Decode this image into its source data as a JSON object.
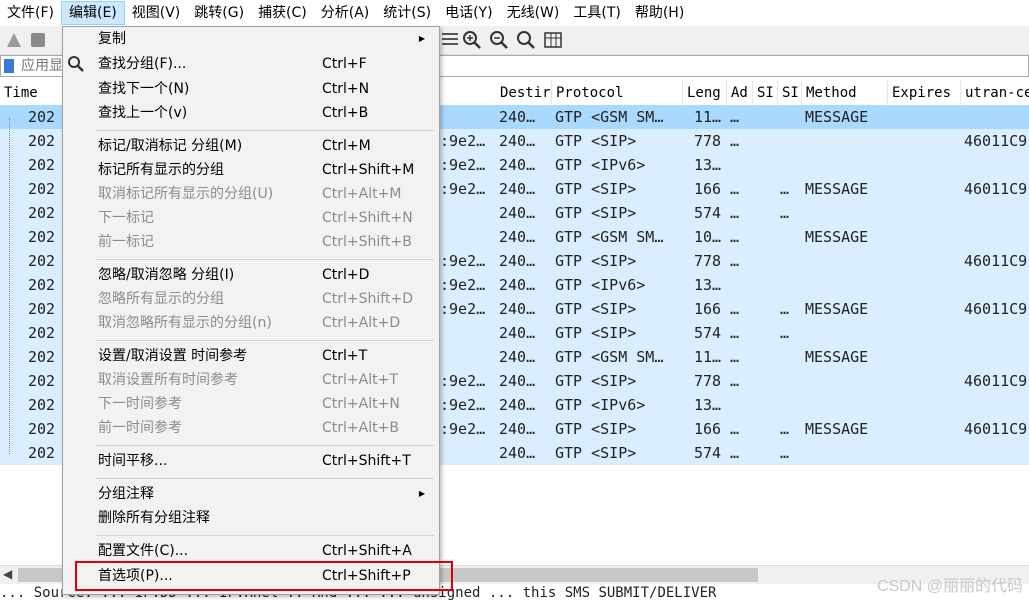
{
  "menubar": {
    "items": [
      "文件(F)",
      "编辑(E)",
      "视图(V)",
      "跳转(G)",
      "捕获(C)",
      "分析(A)",
      "统计(S)",
      "电话(Y)",
      "无线(W)",
      "工具(T)",
      "帮助(H)"
    ]
  },
  "filter": {
    "placeholder": "应用显"
  },
  "columns": [
    "Time",
    "Destir",
    "Protocol",
    "Leng",
    "Ad",
    "SI",
    "SI",
    "Method",
    "Expires",
    "utran-ce"
  ],
  "rows": [
    {
      "time": "202",
      "src": "",
      "dest": "240…",
      "proto": "GTP <GSM SM…",
      "len": "11…",
      "ad": "…",
      "si": "",
      "method": "MESSAGE",
      "utran": ""
    },
    {
      "time": "202",
      "src": ":9e2…",
      "dest": "240…",
      "proto": "GTP <SIP>",
      "len": "778",
      "ad": "…",
      "si": "",
      "method": "",
      "utran": "46011C9"
    },
    {
      "time": "202",
      "src": ":9e2…",
      "dest": "240…",
      "proto": "GTP <IPv6>",
      "len": "13…",
      "ad": "",
      "si": "",
      "method": "",
      "utran": ""
    },
    {
      "time": "202",
      "src": ":9e2…",
      "dest": "240…",
      "proto": "GTP <SIP>",
      "len": "166",
      "ad": "…",
      "si": "…",
      "method": "MESSAGE",
      "utran": "46011C9"
    },
    {
      "time": "202",
      "src": "",
      "dest": "240…",
      "proto": "GTP <SIP>",
      "len": "574",
      "ad": "…",
      "si": "…",
      "method": "",
      "utran": ""
    },
    {
      "time": "202",
      "src": "",
      "dest": "240…",
      "proto": "GTP <GSM SM…",
      "len": "10…",
      "ad": "…",
      "si": "",
      "method": "MESSAGE",
      "utran": ""
    },
    {
      "time": "202",
      "src": ":9e2…",
      "dest": "240…",
      "proto": "GTP <SIP>",
      "len": "778",
      "ad": "…",
      "si": "",
      "method": "",
      "utran": "46011C9"
    },
    {
      "time": "202",
      "src": ":9e2…",
      "dest": "240…",
      "proto": "GTP <IPv6>",
      "len": "13…",
      "ad": "",
      "si": "",
      "method": "",
      "utran": ""
    },
    {
      "time": "202",
      "src": ":9e2…",
      "dest": "240…",
      "proto": "GTP <SIP>",
      "len": "166",
      "ad": "…",
      "si": "…",
      "method": "MESSAGE",
      "utran": "46011C9"
    },
    {
      "time": "202",
      "src": "",
      "dest": "240…",
      "proto": "GTP <SIP>",
      "len": "574",
      "ad": "…",
      "si": "…",
      "method": "",
      "utran": ""
    },
    {
      "time": "202",
      "src": "",
      "dest": "240…",
      "proto": "GTP <GSM SM…",
      "len": "11…",
      "ad": "…",
      "si": "",
      "method": "MESSAGE",
      "utran": ""
    },
    {
      "time": "202",
      "src": ":9e2…",
      "dest": "240…",
      "proto": "GTP <SIP>",
      "len": "778",
      "ad": "…",
      "si": "",
      "method": "",
      "utran": "46011C9"
    },
    {
      "time": "202",
      "src": ":9e2…",
      "dest": "240…",
      "proto": "GTP <IPv6>",
      "len": "13…",
      "ad": "",
      "si": "",
      "method": "",
      "utran": ""
    },
    {
      "time": "202",
      "src": ":9e2…",
      "dest": "240…",
      "proto": "GTP <SIP>",
      "len": "166",
      "ad": "…",
      "si": "…",
      "method": "MESSAGE",
      "utran": "46011C9"
    },
    {
      "time": "202",
      "src": "",
      "dest": "240…",
      "proto": "GTP <SIP>",
      "len": "574",
      "ad": "…",
      "si": "…",
      "method": "",
      "utran": ""
    }
  ],
  "edit_menu": {
    "copy": "复制",
    "find_packet": {
      "label": "查找分组(F)...",
      "shortcut": "Ctrl+F"
    },
    "find_next": {
      "label": "查找下一个(N)",
      "shortcut": "Ctrl+N"
    },
    "find_prev": {
      "label": "查找上一个(v)",
      "shortcut": "Ctrl+B"
    },
    "mark": {
      "label": "标记/取消标记 分组(M)",
      "shortcut": "Ctrl+M"
    },
    "mark_all": {
      "label": "标记所有显示的分组",
      "shortcut": "Ctrl+Shift+M"
    },
    "unmark_all": {
      "label": "取消标记所有显示的分组(U)",
      "shortcut": "Ctrl+Alt+M"
    },
    "next_mark": {
      "label": "下一标记",
      "shortcut": "Ctrl+Shift+N"
    },
    "prev_mark": {
      "label": "前一标记",
      "shortcut": "Ctrl+Shift+B"
    },
    "ignore": {
      "label": "忽略/取消忽略 分组(I)",
      "shortcut": "Ctrl+D"
    },
    "ignore_all": {
      "label": "忽略所有显示的分组",
      "shortcut": "Ctrl+Shift+D"
    },
    "unignore_all": {
      "label": "取消忽略所有显示的分组(n)",
      "shortcut": "Ctrl+Alt+D"
    },
    "time_ref": {
      "label": "设置/取消设置 时间参考",
      "shortcut": "Ctrl+T"
    },
    "unset_time_refs": {
      "label": "取消设置所有时间参考",
      "shortcut": "Ctrl+Alt+T"
    },
    "next_time_ref": {
      "label": "下一时间参考",
      "shortcut": "Ctrl+Alt+N"
    },
    "prev_time_ref": {
      "label": "前一时间参考",
      "shortcut": "Ctrl+Alt+B"
    },
    "time_shift": {
      "label": "时间平移...",
      "shortcut": "Ctrl+Shift+T"
    },
    "packet_comment": "分组注释",
    "delete_comments": "删除所有分组注释",
    "profiles": {
      "label": "配置文件(C)...",
      "shortcut": "Ctrl+Shift+A"
    },
    "preferences": {
      "label": "首选项(P)...",
      "shortcut": "Ctrl+Shift+P"
    }
  },
  "detail_line": "... Source: ... IP.DD ... IP.Rnel .. Rnd ... ... unsigned ... this SMS SUBMIT/DELIVER",
  "watermark": "CSDN @丽丽的代码"
}
